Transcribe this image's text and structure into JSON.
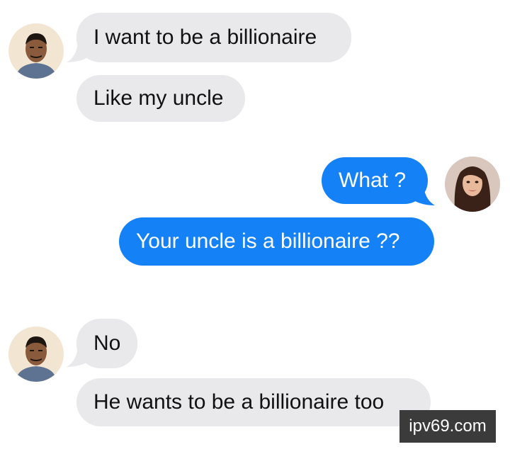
{
  "messages": [
    {
      "text": "I want to be a billionaire",
      "sender": "uncle-friend"
    },
    {
      "text": "Like my uncle",
      "sender": "uncle-friend"
    },
    {
      "text": "What ?",
      "sender": "woman"
    },
    {
      "text": "Your uncle is a billionaire ??",
      "sender": "woman"
    },
    {
      "text": "No",
      "sender": "uncle-friend"
    },
    {
      "text": "He wants to be a billionaire too",
      "sender": "uncle-friend"
    }
  ],
  "watermark": "ipv69.com",
  "colors": {
    "received": "#e9e9eb",
    "sent": "#1482f6",
    "background": "#ffffff"
  }
}
